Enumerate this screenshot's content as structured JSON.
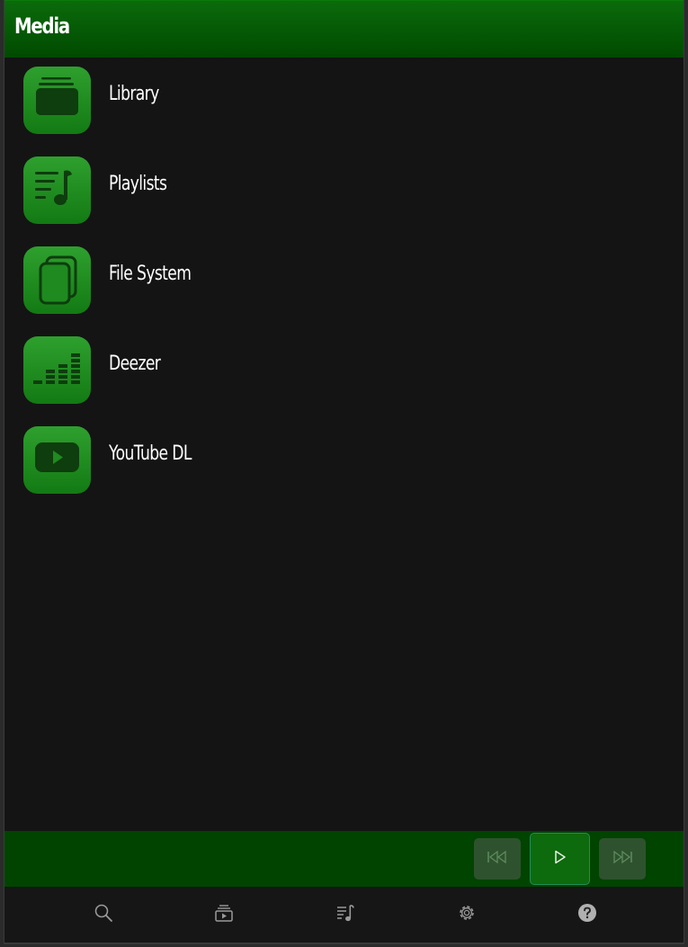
{
  "header": {
    "title": "Media"
  },
  "menu": {
    "items": [
      {
        "label": "Library",
        "icon": "library-icon"
      },
      {
        "label": "Playlists",
        "icon": "playlist-icon"
      },
      {
        "label": "File System",
        "icon": "files-icon"
      },
      {
        "label": "Deezer",
        "icon": "equalizer-icon"
      },
      {
        "label": "YouTube DL",
        "icon": "youtube-icon"
      }
    ]
  },
  "player": {
    "controls": [
      "previous-icon",
      "play-icon",
      "next-icon"
    ]
  },
  "bottom_nav": {
    "items": [
      "search-icon",
      "now-playing-icon",
      "queue-icon",
      "settings-icon",
      "help-icon"
    ]
  },
  "colors": {
    "accent": "#137a13",
    "header_top": "#0b6b0b",
    "header_bottom": "#004a00",
    "background": "#141414",
    "player_bar": "#004400"
  }
}
